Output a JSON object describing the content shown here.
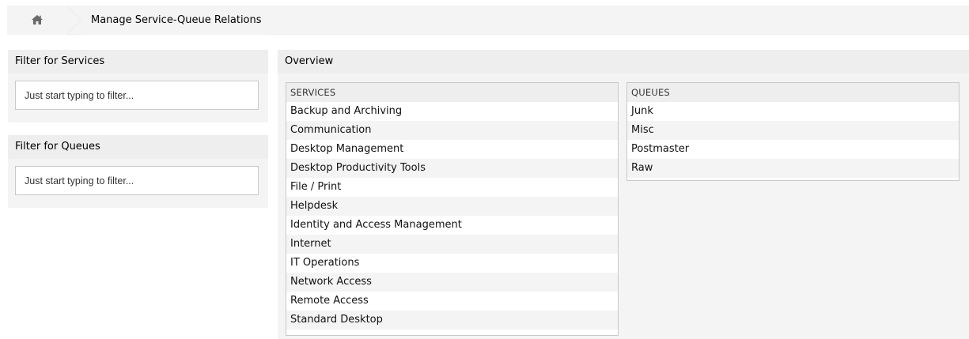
{
  "breadcrumb": {
    "home_icon": "home-icon",
    "title": "Manage Service-Queue Relations"
  },
  "filter_services": {
    "title": "Filter for Services",
    "placeholder": "Just start typing to filter..."
  },
  "filter_queues": {
    "title": "Filter for Queues",
    "placeholder": "Just start typing to filter..."
  },
  "overview": {
    "title": "Overview",
    "services_header": "SERVICES",
    "services": [
      "Backup and Archiving",
      "Communication",
      "Desktop Management",
      "Desktop Productivity Tools",
      "File / Print",
      "Helpdesk",
      "Identity and Access Management",
      "Internet",
      "IT Operations",
      "Network Access",
      "Remote Access",
      "Standard Desktop"
    ],
    "queues_header": "QUEUES",
    "queues": [
      "Junk",
      "Misc",
      "Postmaster",
      "Raw"
    ]
  }
}
